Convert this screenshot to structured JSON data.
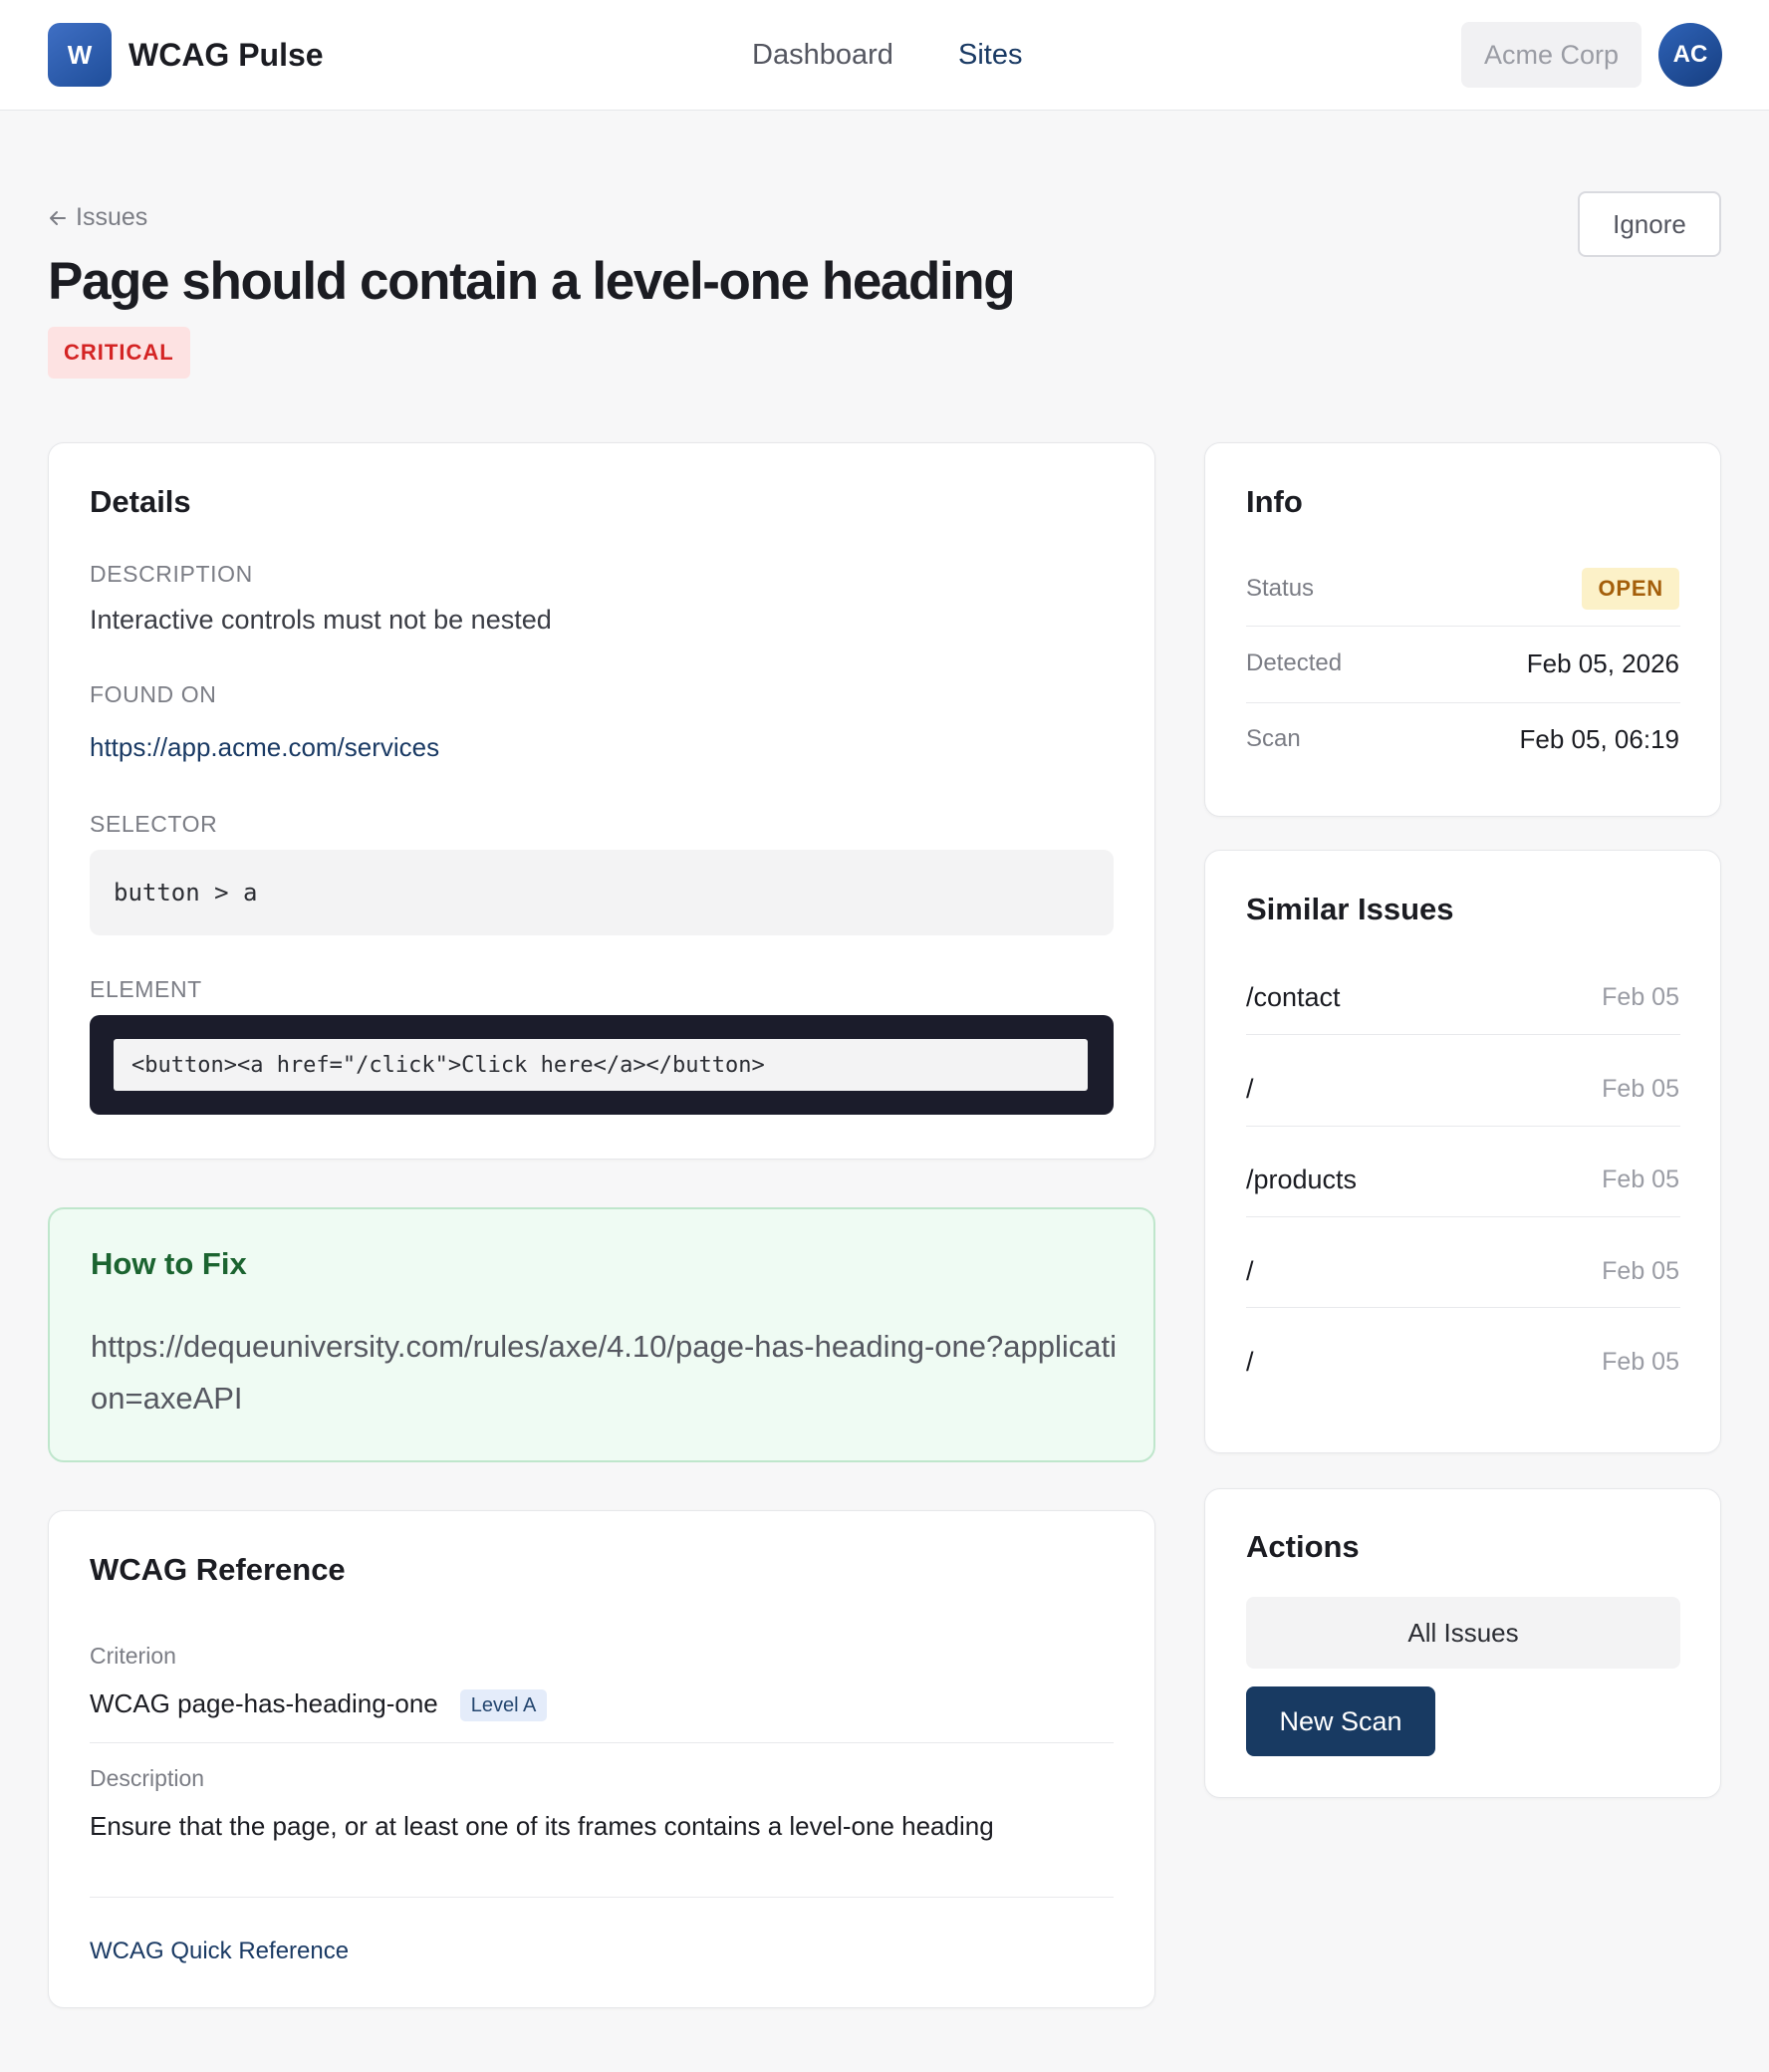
{
  "header": {
    "logo_letter": "W",
    "brand": "WCAG Pulse",
    "nav": [
      {
        "label": "Dashboard",
        "active": false
      },
      {
        "label": "Sites",
        "active": true
      }
    ],
    "org": "Acme Corp",
    "avatar_initials": "AC"
  },
  "page": {
    "back_label": "Issues",
    "title": "Page should contain a level-one heading",
    "severity": "CRITICAL",
    "ignore_label": "Ignore"
  },
  "details": {
    "title": "Details",
    "description_label": "DESCRIPTION",
    "description": "Interactive controls must not be nested",
    "found_on_label": "FOUND ON",
    "found_on": "https://app.acme.com/services",
    "selector_label": "SELECTOR",
    "selector": "button > a",
    "element_label": "ELEMENT",
    "element": "<button><a href=\"/click\">Click here</a></button>"
  },
  "fix": {
    "title": "How to Fix",
    "text": "https://dequeuniversity.com/rules/axe/4.10/page-has-heading-one?application=axeAPI"
  },
  "wcag": {
    "title": "WCAG Reference",
    "criterion_label": "Criterion",
    "criterion": "WCAG page-has-heading-one",
    "level": "Level A",
    "description_label": "Description",
    "description": "Ensure that the page, or at least one of its frames contains a level-one heading",
    "quick_ref": "WCAG Quick Reference"
  },
  "info": {
    "title": "Info",
    "status_label": "Status",
    "status": "OPEN",
    "detected_label": "Detected",
    "detected": "Feb 05, 2026",
    "scan_label": "Scan",
    "scan": "Feb 05, 06:19"
  },
  "similar": {
    "title": "Similar Issues",
    "items": [
      {
        "path": "/contact",
        "date": "Feb 05"
      },
      {
        "path": "/",
        "date": "Feb 05"
      },
      {
        "path": "/products",
        "date": "Feb 05"
      },
      {
        "path": "/",
        "date": "Feb 05"
      },
      {
        "path": "/",
        "date": "Feb 05"
      }
    ]
  },
  "actions": {
    "title": "Actions",
    "all_issues": "All Issues",
    "new_scan": "New Scan"
  },
  "colors": {
    "accent": "#183a62",
    "critical": "#d42424",
    "open": "#a45e0a",
    "fix_bg": "#effbf3"
  }
}
